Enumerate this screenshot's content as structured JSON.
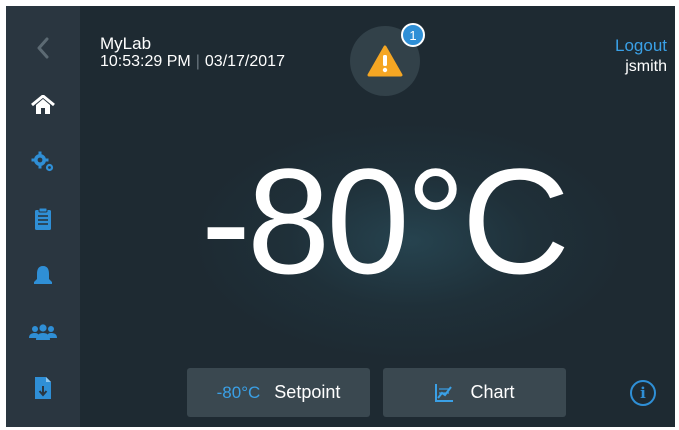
{
  "header": {
    "site_name": "MyLab",
    "time": "10:53:29 PM",
    "separator": "|",
    "date": "03/17/2017"
  },
  "alert": {
    "count": "1",
    "icon": "warning-triangle-icon",
    "color": "#f5a623"
  },
  "account": {
    "logout_label": "Logout",
    "username": "jsmith"
  },
  "sidebar": {
    "items": [
      {
        "icon": "back-chevron-icon"
      },
      {
        "icon": "home-icon",
        "active": true
      },
      {
        "icon": "settings-gears-icon"
      },
      {
        "icon": "clipboard-icon"
      },
      {
        "icon": "bell-icon"
      },
      {
        "icon": "users-icon"
      },
      {
        "icon": "file-download-icon"
      }
    ]
  },
  "main": {
    "temperature": "-80°C"
  },
  "buttons": {
    "setpoint_value": "-80°C",
    "setpoint_label": "Setpoint",
    "chart_label": "Chart",
    "chart_icon": "chart-icon"
  },
  "info": {
    "icon": "info-icon",
    "glyph": "i"
  },
  "colors": {
    "background": "#1e2a32",
    "sidebar": "#2a3640",
    "accent": "#3aa0e6",
    "button": "#3a4850"
  }
}
